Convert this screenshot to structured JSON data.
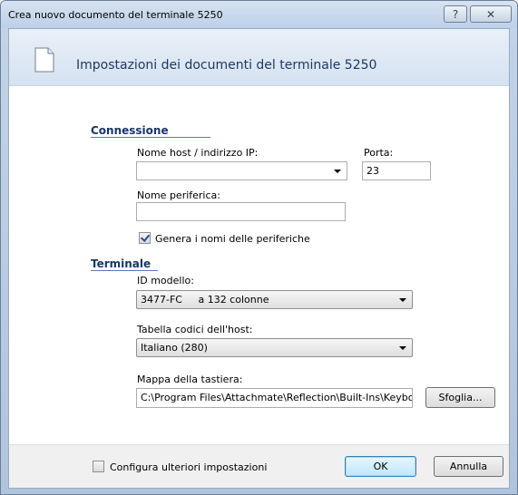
{
  "window": {
    "title": "Crea nuovo documento del terminale 5250",
    "help_glyph": "?",
    "close_glyph": "✕",
    "icon": "document-icon"
  },
  "header": {
    "title": "Impostazioni dei documenti del terminale 5250"
  },
  "connessione": {
    "heading": "Connessione",
    "host_label": "Nome host / indirizzo IP:",
    "host_value": "",
    "port_label": "Porta:",
    "port_value": "23",
    "device_label": "Nome periferica:",
    "device_value": "",
    "generate_label": "Genera i nomi delle periferiche",
    "generate_checked": true
  },
  "terminale": {
    "heading": "Terminale",
    "model_label": "ID modello:",
    "model_value": "3477-FC     a 132 colonne",
    "codepage_label": "Tabella codici dell'host:",
    "codepage_value": "Italiano (280)",
    "keymap_label": "Mappa della tastiera:",
    "keymap_value": "C:\\Program Files\\Attachmate\\Reflection\\Built-Ins\\Keybo",
    "browse_label": "Sfoglia..."
  },
  "footer": {
    "more_settings_label": "Configura ulteriori impostazioni",
    "more_settings_checked": false,
    "ok_label": "OK",
    "cancel_label": "Annulla"
  }
}
